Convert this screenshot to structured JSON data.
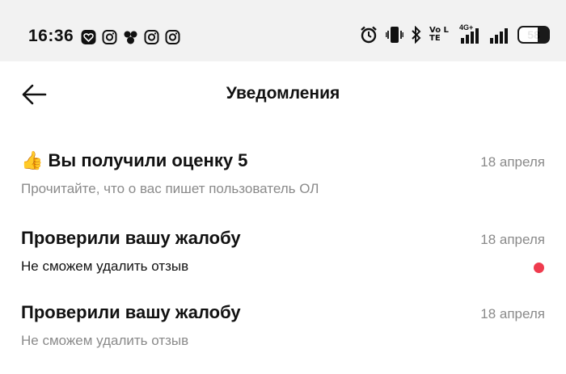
{
  "status_bar": {
    "time": "16:36",
    "left_icons": [
      "heart-app-icon",
      "instagram-icon",
      "dots-app-icon",
      "instagram-icon",
      "instagram-icon"
    ],
    "volte": "Vo LTE",
    "network": "4G+",
    "battery": "58"
  },
  "header": {
    "title": "Уведомления"
  },
  "notifications": [
    {
      "emoji": "👍",
      "title": "Вы получили оценку 5",
      "subtitle": "Прочитайте, что о вас пишет пользователь ОЛ",
      "date": "18 апреля",
      "unread": false
    },
    {
      "emoji": "",
      "title": "Проверили вашу жалобу",
      "subtitle": "Не сможем удалить отзыв",
      "date": "18 апреля",
      "unread": true
    },
    {
      "emoji": "",
      "title": "Проверили вашу жалобу",
      "subtitle": "Не сможем удалить отзыв",
      "date": "18 апреля",
      "unread": false
    }
  ],
  "colors": {
    "status_bg": "#f2f2f2",
    "unread_dot": "#ef3b4e",
    "secondary_text": "#8a8a8a"
  }
}
